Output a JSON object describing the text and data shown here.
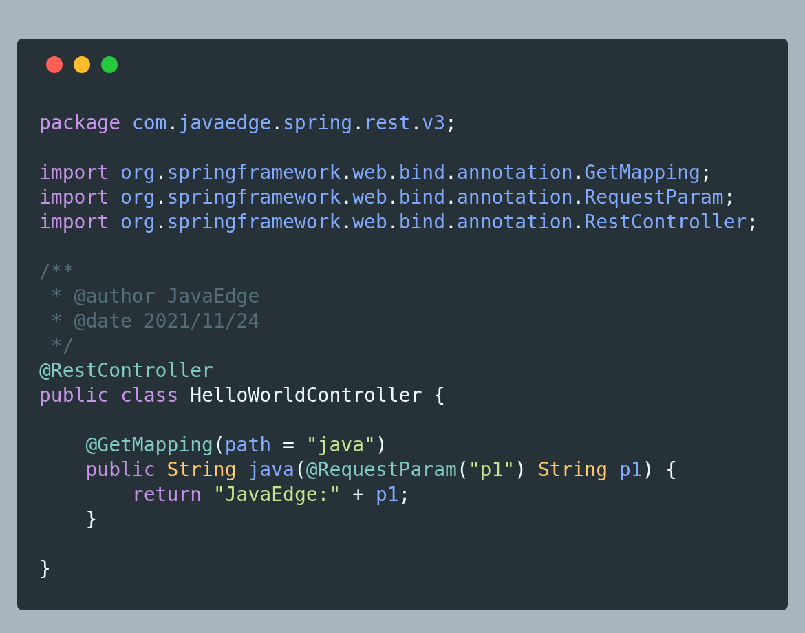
{
  "code_window": {
    "lines": [
      {
        "kind": "code",
        "tokens": [
          {
            "kind": "keyword",
            "text": "package "
          },
          {
            "kind": "name",
            "text": "com"
          },
          {
            "kind": "plain",
            "text": "."
          },
          {
            "kind": "name",
            "text": "javaedge"
          },
          {
            "kind": "plain",
            "text": "."
          },
          {
            "kind": "name",
            "text": "spring"
          },
          {
            "kind": "plain",
            "text": "."
          },
          {
            "kind": "name",
            "text": "rest"
          },
          {
            "kind": "plain",
            "text": "."
          },
          {
            "kind": "name",
            "text": "v3"
          },
          {
            "kind": "plain",
            "text": ";"
          }
        ]
      },
      {
        "kind": "blank"
      },
      {
        "kind": "code",
        "tokens": [
          {
            "kind": "keyword",
            "text": "import "
          },
          {
            "kind": "name",
            "text": "org"
          },
          {
            "kind": "plain",
            "text": "."
          },
          {
            "kind": "name",
            "text": "springframework"
          },
          {
            "kind": "plain",
            "text": "."
          },
          {
            "kind": "name",
            "text": "web"
          },
          {
            "kind": "plain",
            "text": "."
          },
          {
            "kind": "name",
            "text": "bind"
          },
          {
            "kind": "plain",
            "text": "."
          },
          {
            "kind": "name",
            "text": "annotation"
          },
          {
            "kind": "plain",
            "text": "."
          },
          {
            "kind": "name",
            "text": "GetMapping"
          },
          {
            "kind": "plain",
            "text": ";"
          }
        ]
      },
      {
        "kind": "code",
        "tokens": [
          {
            "kind": "keyword",
            "text": "import "
          },
          {
            "kind": "name",
            "text": "org"
          },
          {
            "kind": "plain",
            "text": "."
          },
          {
            "kind": "name",
            "text": "springframework"
          },
          {
            "kind": "plain",
            "text": "."
          },
          {
            "kind": "name",
            "text": "web"
          },
          {
            "kind": "plain",
            "text": "."
          },
          {
            "kind": "name",
            "text": "bind"
          },
          {
            "kind": "plain",
            "text": "."
          },
          {
            "kind": "name",
            "text": "annotation"
          },
          {
            "kind": "plain",
            "text": "."
          },
          {
            "kind": "name",
            "text": "RequestParam"
          },
          {
            "kind": "plain",
            "text": ";"
          }
        ]
      },
      {
        "kind": "code",
        "tokens": [
          {
            "kind": "keyword",
            "text": "import "
          },
          {
            "kind": "name",
            "text": "org"
          },
          {
            "kind": "plain",
            "text": "."
          },
          {
            "kind": "name",
            "text": "springframework"
          },
          {
            "kind": "plain",
            "text": "."
          },
          {
            "kind": "name",
            "text": "web"
          },
          {
            "kind": "plain",
            "text": "."
          },
          {
            "kind": "name",
            "text": "bind"
          },
          {
            "kind": "plain",
            "text": "."
          },
          {
            "kind": "name",
            "text": "annotation"
          },
          {
            "kind": "plain",
            "text": "."
          },
          {
            "kind": "name",
            "text": "RestController"
          },
          {
            "kind": "plain",
            "text": ";"
          }
        ]
      },
      {
        "kind": "blank"
      },
      {
        "kind": "code",
        "tokens": [
          {
            "kind": "comment",
            "text": "/**"
          }
        ]
      },
      {
        "kind": "code",
        "tokens": [
          {
            "kind": "comment",
            "text": " * @author JavaEdge"
          }
        ]
      },
      {
        "kind": "code",
        "tokens": [
          {
            "kind": "comment",
            "text": " * @date 2021/11/24"
          }
        ]
      },
      {
        "kind": "code",
        "tokens": [
          {
            "kind": "comment",
            "text": " */"
          }
        ]
      },
      {
        "kind": "code",
        "tokens": [
          {
            "kind": "annotation",
            "text": "@RestController"
          }
        ]
      },
      {
        "kind": "code",
        "tokens": [
          {
            "kind": "keyword",
            "text": "public class "
          },
          {
            "kind": "plain",
            "text": "HelloWorldController {"
          }
        ]
      },
      {
        "kind": "blank"
      },
      {
        "kind": "code",
        "tokens": [
          {
            "kind": "annotation",
            "text": "    @GetMapping"
          },
          {
            "kind": "plain",
            "text": "("
          },
          {
            "kind": "name",
            "text": "path"
          },
          {
            "kind": "plain",
            "text": " = "
          },
          {
            "kind": "string",
            "text": "\"java\""
          },
          {
            "kind": "plain",
            "text": ")"
          }
        ]
      },
      {
        "kind": "code",
        "tokens": [
          {
            "kind": "keyword",
            "text": "    public "
          },
          {
            "kind": "type",
            "text": "String "
          },
          {
            "kind": "name",
            "text": "java"
          },
          {
            "kind": "plain",
            "text": "("
          },
          {
            "kind": "annotation",
            "text": "@RequestParam"
          },
          {
            "kind": "plain",
            "text": "("
          },
          {
            "kind": "string",
            "text": "\"p1\""
          },
          {
            "kind": "plain",
            "text": ") "
          },
          {
            "kind": "type",
            "text": "String "
          },
          {
            "kind": "name",
            "text": "p1"
          },
          {
            "kind": "plain",
            "text": ") {"
          }
        ]
      },
      {
        "kind": "code",
        "tokens": [
          {
            "kind": "keyword",
            "text": "        return "
          },
          {
            "kind": "string",
            "text": "\"JavaEdge:\""
          },
          {
            "kind": "plain",
            "text": " + "
          },
          {
            "kind": "name",
            "text": "p1"
          },
          {
            "kind": "plain",
            "text": ";"
          }
        ]
      },
      {
        "kind": "code",
        "tokens": [
          {
            "kind": "plain",
            "text": "    }"
          }
        ]
      },
      {
        "kind": "blank"
      },
      {
        "kind": "code",
        "tokens": [
          {
            "kind": "plain",
            "text": "}"
          }
        ]
      }
    ]
  }
}
